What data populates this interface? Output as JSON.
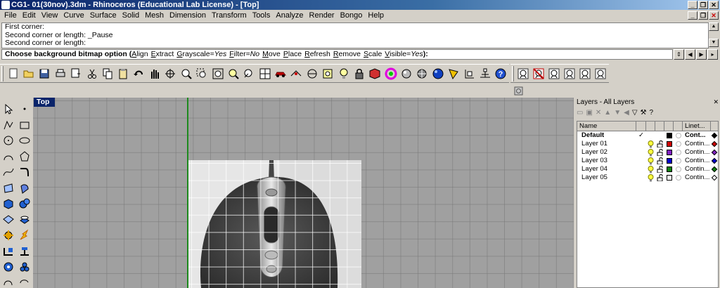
{
  "window": {
    "title": "CG1- 01(30nov).3dm - Rhinoceros (Educational Lab License) - [Top]"
  },
  "menu": [
    "File",
    "Edit",
    "View",
    "Curve",
    "Surface",
    "Solid",
    "Mesh",
    "Dimension",
    "Transform",
    "Tools",
    "Analyze",
    "Render",
    "Bongo",
    "Help"
  ],
  "command_history": [
    "First corner:",
    "Second corner or length: _Pause",
    "Second corner or length:"
  ],
  "command_prompt": {
    "text": "Choose background bitmap option (",
    "options": [
      {
        "u": "A",
        "rest": "lign"
      },
      {
        "u": "E",
        "rest": "xtract"
      },
      {
        "u": "G",
        "rest": "rayscale=",
        "val": "Yes"
      },
      {
        "u": "F",
        "rest": "ilter=",
        "val": "No"
      },
      {
        "u": "M",
        "rest": "ove"
      },
      {
        "u": "P",
        "rest": "lace"
      },
      {
        "u": "R",
        "rest": "efresh"
      },
      {
        "u": "R",
        "rest": "emove"
      },
      {
        "u": "S",
        "rest": "cale"
      },
      {
        "u": "V",
        "rest": "isible=",
        "val": "Yes"
      }
    ],
    "end": "):"
  },
  "viewport": {
    "label": "Top"
  },
  "toolbar_icons": [
    "new-icon",
    "open-icon",
    "save-icon",
    "print-icon",
    "import-icon",
    "cut-icon",
    "copy-icon",
    "paste-icon",
    "undo-icon",
    "pan-icon",
    "rotate-view-icon",
    "zoom-icon",
    "zoom-window-icon",
    "zoom-extents-icon",
    "zoom-selected-icon",
    "redo-view-icon",
    "four-viewports-icon",
    "car-icon",
    "grid-snap-icon",
    "ortho-icon",
    "osnap-icon",
    "light-icon",
    "lock-icon",
    "shaded-icon",
    "color-wheel-icon",
    "material-icon",
    "render-icon",
    "sphere-icon",
    "mark-icon",
    "cplane-icon",
    "dimension-icon",
    "help-icon"
  ],
  "toolbar_right_icons": [
    "camera-icon",
    "no-camera-icon",
    "face-icon",
    "face-alt-icon",
    "face-box-icon",
    "face-small-icon"
  ],
  "layers": {
    "title": "Layers - All Layers",
    "columns": [
      "Name",
      "Linet..."
    ],
    "rows": [
      {
        "name": "Default",
        "current": "✓",
        "color": "#000000",
        "linetype": "Cont...",
        "bold": true
      },
      {
        "name": "Layer 01",
        "current": "",
        "color": "#d00000",
        "linetype": "Contin..."
      },
      {
        "name": "Layer 02",
        "current": "",
        "color": "#8020c0",
        "linetype": "Contin..."
      },
      {
        "name": "Layer 03",
        "current": "",
        "color": "#0000d0",
        "linetype": "Contin..."
      },
      {
        "name": "Layer 04",
        "current": "",
        "color": "#108010",
        "linetype": "Contin..."
      },
      {
        "name": "Layer 05",
        "current": "",
        "color": "#ffffff",
        "linetype": "Contin..."
      }
    ]
  }
}
